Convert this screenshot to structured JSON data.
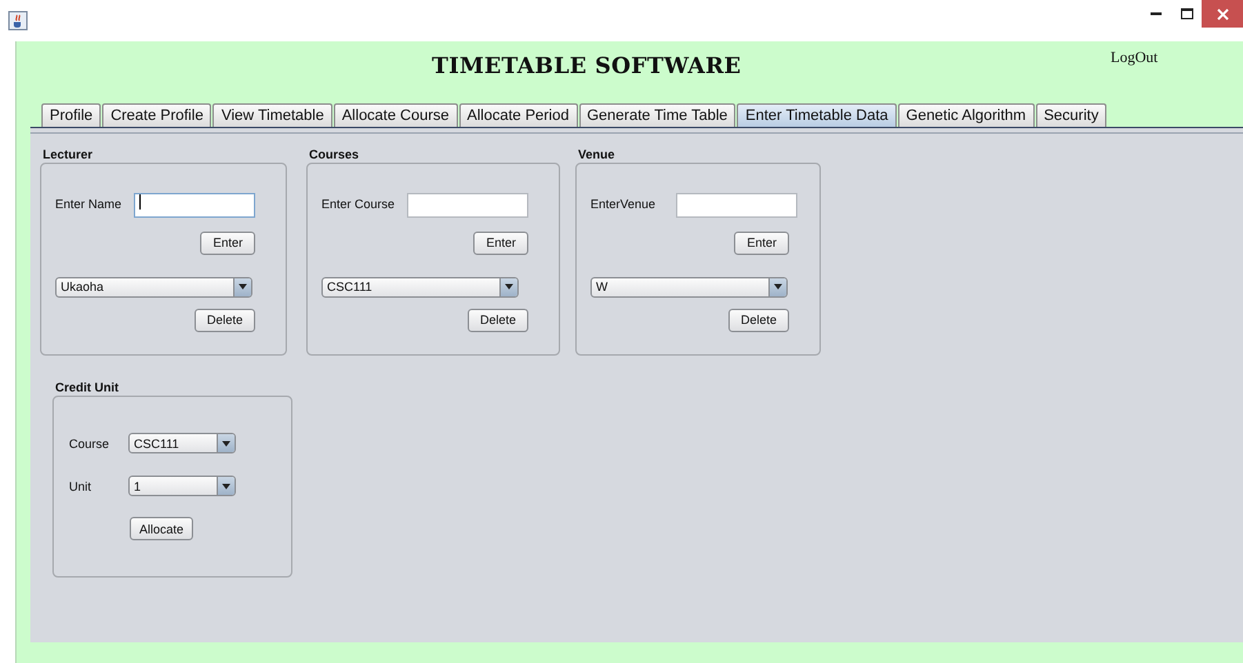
{
  "header": {
    "title": "TIMETABLE SOFTWARE",
    "logout": "LogOut"
  },
  "tabs": [
    {
      "label": "Profile",
      "selected": false
    },
    {
      "label": "Create Profile",
      "selected": false
    },
    {
      "label": "View Timetable",
      "selected": false
    },
    {
      "label": "Allocate Course",
      "selected": false
    },
    {
      "label": "Allocate Period",
      "selected": false
    },
    {
      "label": "Generate Time Table",
      "selected": false
    },
    {
      "label": "Enter Timetable Data",
      "selected": true
    },
    {
      "label": "Genetic Algorithm",
      "selected": false
    },
    {
      "label": "Security",
      "selected": false
    }
  ],
  "groups": [
    {
      "title": "Lecturer",
      "field_label": "Enter Name",
      "focused": true,
      "enter_button": "Enter",
      "dropdown": "Ukaoha",
      "delete_button": "Delete"
    },
    {
      "title": "Courses",
      "field_label": "Enter Course",
      "focused": false,
      "enter_button": "Enter",
      "dropdown": "CSC111",
      "delete_button": "Delete"
    },
    {
      "title": "Venue",
      "field_label": "EnterVenue",
      "focused": false,
      "enter_button": "Enter",
      "dropdown": "W",
      "delete_button": "Delete"
    }
  ],
  "credit_unit": {
    "title": "Credit Unit",
    "rows": [
      {
        "label": "Course",
        "value": "CSC111"
      },
      {
        "label": "Unit",
        "value": "1"
      }
    ],
    "button": "Allocate"
  }
}
